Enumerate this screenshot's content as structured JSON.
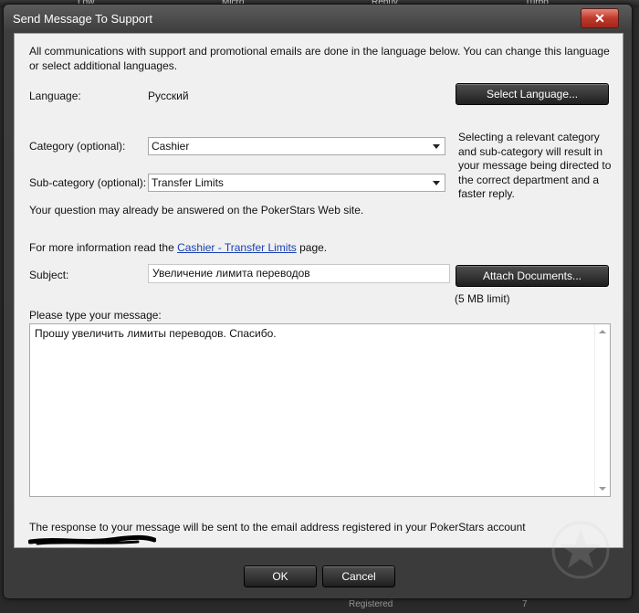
{
  "background": {
    "columns": [
      "Low",
      "Micro",
      "Rebuy",
      "Turbo"
    ],
    "bottom_text": "Registered",
    "bottom_number": "7"
  },
  "window": {
    "title": "Send Message To Support",
    "close_label": "✕"
  },
  "form": {
    "intro": "All communications with support and promotional emails are done in the language below. You can change this language or select additional languages.",
    "language_label": "Language:",
    "language_value": "Русский",
    "select_language_button": "Select Language...",
    "category_label": "Category (optional):",
    "category_value": "Cashier",
    "subcategory_label": "Sub-category (optional):",
    "subcategory_value": "Transfer Limits",
    "category_hint": "Selecting a relevant category and sub-category will result in your message being directed to the correct department and a faster reply.",
    "faq_note": "Your question may already be answered on the PokerStars Web site.",
    "more_info_prefix": "For more information read the ",
    "more_info_link": "Cashier - Transfer Limits",
    "more_info_suffix": " page.",
    "subject_label": "Subject:",
    "subject_value": "Увеличение лимита переводов",
    "attach_button": "Attach Documents...",
    "attach_limit": "(5 MB limit)",
    "message_label": "Please type your message:",
    "message_value": "Прошу увеличить лимиты переводов. Спасибо.",
    "response_note": "The response to your message will be sent to the email address registered in your PokerStars account"
  },
  "buttons": {
    "ok": "OK",
    "cancel": "Cancel"
  }
}
